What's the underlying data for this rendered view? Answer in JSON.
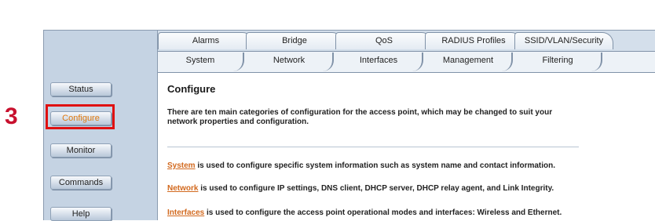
{
  "step_number": "3",
  "tabs": {
    "row1": [
      "Alarms",
      "Bridge",
      "QoS",
      "RADIUS Profiles",
      "SSID/VLAN/Security"
    ],
    "row2": [
      "System",
      "Network",
      "Interfaces",
      "Management",
      "Filtering"
    ]
  },
  "sidebar": {
    "status": "Status",
    "configure": "Configure",
    "monitor": "Monitor",
    "commands": "Commands",
    "help": "Help"
  },
  "content": {
    "title": "Configure",
    "intro": "There are ten main categories of configuration for the access point, which may be changed to suit your network properties and configuration.",
    "items": [
      {
        "link": "System",
        "text": " is used to configure specific system information such as system name and contact information."
      },
      {
        "link": "Network",
        "text": " is used to configure IP settings, DNS client, DHCP server, DHCP relay agent, and Link Integrity."
      },
      {
        "link": "Interfaces",
        "text": " is used to configure the access point operational modes and interfaces: Wireless and Ethernet."
      }
    ]
  },
  "colors": {
    "step_number": "#c8102e",
    "highlight": "#e01010",
    "link": "#d2691e",
    "sidebar_bg": "#c5d3e3"
  }
}
